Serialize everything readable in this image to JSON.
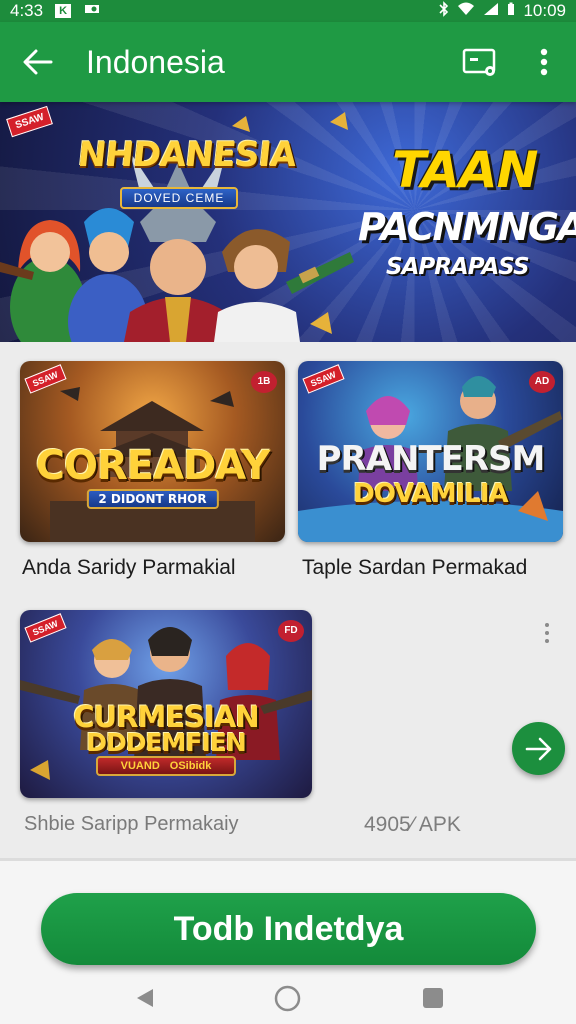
{
  "status_bar": {
    "time": "4:33",
    "clock": "10:09"
  },
  "app_bar": {
    "title": "Indonesia"
  },
  "hero": {
    "badge": "SSAW",
    "logo_text": "NHDANESIA",
    "logo_plate": "DOVED CEME",
    "title_line1": "TAAN",
    "title_line2": "PACNMNGA",
    "title_line3": "SAPRAPASS"
  },
  "games": [
    {
      "badge": "SSAW",
      "corner": "1B",
      "title": "COREADAY",
      "subtitle": "2 DIDONT RHOR",
      "label": "Anda Saridy Parmakial"
    },
    {
      "badge": "SSAW",
      "corner": "AD",
      "title": "PRANTERSM",
      "subtitle": "DOVAMILIA",
      "label": "Taple Sardan Permakad"
    },
    {
      "badge": "SSAW",
      "corner": "FD",
      "title": "CURMESIAN",
      "subtitle": "DDDEMFIEN",
      "tag1": "VUAND",
      "tag2": "OSibidk",
      "label": "Shbie Saripp Permakaiy"
    }
  ],
  "apk_size": "4905⁄ APK",
  "cta_label": "Todb Indetdya",
  "colors": {
    "primary": "#1f9a44",
    "status_bar": "#1d8c3c",
    "accent_gold": "#ffd23a"
  }
}
